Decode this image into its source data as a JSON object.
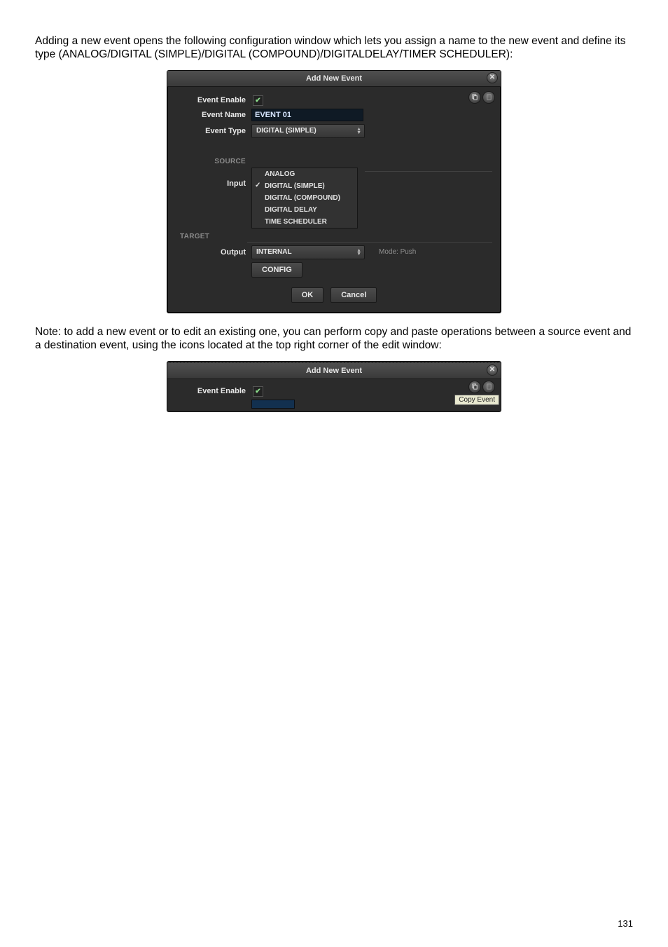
{
  "para1": "Adding a new event opens the following configuration window which lets you assign a name to the new event and define its type (ANALOG/DIGITAL (SIMPLE)/DIGITAL (COMPOUND)/DIGITALDELAY/TIMER SCHEDULER):",
  "para2": "Note: to add a new event or to edit an existing one, you can perform copy and paste operations between a source event and a destination event, using the icons located at the top right corner of the edit window:",
  "dlg1": {
    "title": "Add New Event",
    "enable_label": "Event Enable",
    "name_label": "Event Name",
    "name_value": "EVENT 01",
    "type_label": "Event Type",
    "type_value": "DIGITAL (SIMPLE)",
    "source_header": "SOURCE",
    "input_label": "Input",
    "dropdown_items": [
      "ANALOG",
      "DIGITAL (SIMPLE)",
      "DIGITAL (COMPOUND)",
      "DIGITAL DELAY",
      "TIME SCHEDULER"
    ],
    "target_header": "TARGET",
    "output_label": "Output",
    "output_value": "INTERNAL",
    "mode_text": "Mode: Push",
    "config_btn": "CONFIG",
    "ok_btn": "OK",
    "cancel_btn": "Cancel"
  },
  "dlg2": {
    "title": "Add New Event",
    "enable_label": "Event Enable",
    "tooltip": "Copy Event"
  },
  "page_number": "131"
}
